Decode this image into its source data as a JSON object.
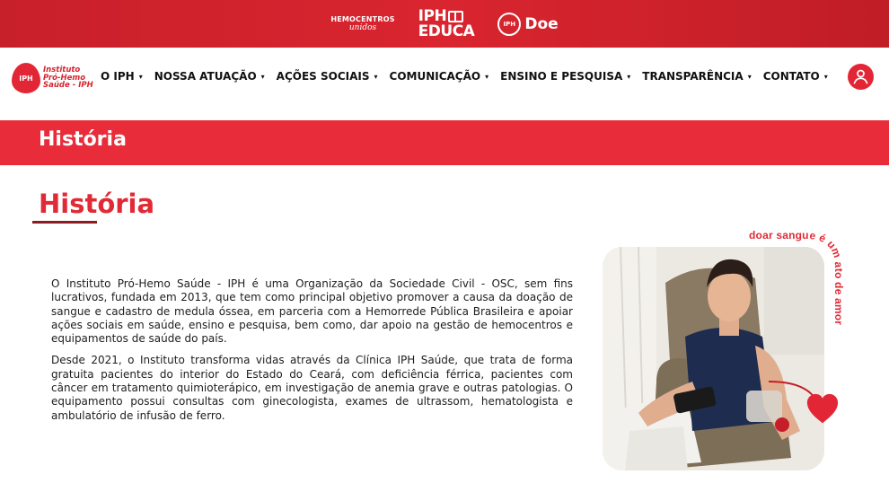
{
  "topbar": {
    "hemocentros": "HEMOCENTROS",
    "unidos": "unidos",
    "educa_line1": "IPH",
    "educa_line2": "EDUCA",
    "doe_badge": "IPH",
    "doe": "Doe"
  },
  "logo": {
    "badge": "IPH",
    "line1": "Instituto",
    "line2": "Pró-Hemo",
    "line3": "Saúde - IPH"
  },
  "nav": {
    "items": [
      {
        "label": "O IPH"
      },
      {
        "label": "NOSSA ATUAÇÃO"
      },
      {
        "label": "AÇÕES SOCIAIS"
      },
      {
        "label": "COMUNICAÇÃO"
      },
      {
        "label": "ENSINO E PESQUISA"
      },
      {
        "label": "TRANSPARÊNCIA"
      },
      {
        "label": "CONTATO"
      }
    ]
  },
  "page": {
    "banner_title": "História",
    "section_title": "História",
    "paragraphs": [
      "O Instituto Pró-Hemo Saúde - IPH é uma Organização da Sociedade Civil - OSC, sem fins lucrativos, fundada em 2013, que tem como principal objetivo promover a causa da doação de sangue e cadastro de medula óssea, em parceria com a Hemorrede Pública Brasileira e apoiar ações sociais em saúde, ensino e pesquisa, bem como, dar apoio na gestão de hemocentros e equipamentos de saúde do país.",
      "Desde 2021, o Instituto transforma vidas através da Clínica IPH Saúde, que trata de forma gratuita pacientes do interior do Estado do Ceará, com deficiência férrica, pacientes com câncer em tratamento quimioterápico, em investigação de anemia grave e outras patologias. O equipamento possui consultas com ginecologista, exames de ultrassom, hematologista e ambulatório de infusão de ferro."
    ],
    "photo_caption": "doar sangue é um ato de amor"
  },
  "colors": {
    "brand_red": "#e32636",
    "banner_red": "#e82c3a",
    "underline": "#8b1c22"
  },
  "icons": {
    "user": "user-icon",
    "heart": "heart-icon",
    "book": "book-icon"
  }
}
